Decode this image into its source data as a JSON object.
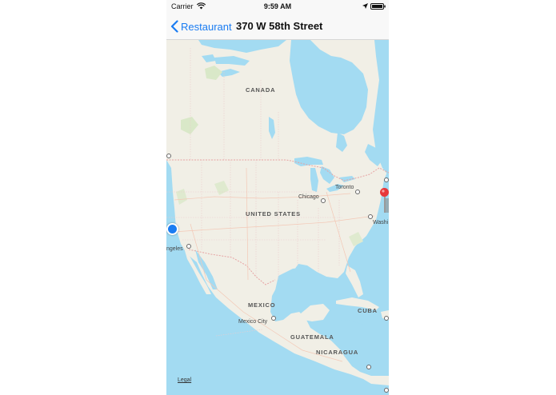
{
  "status_bar": {
    "carrier": "Carrier",
    "time": "9:59 AM"
  },
  "nav": {
    "back_label": "Restaurant",
    "title": "370 W 58th Street"
  },
  "map": {
    "labels": {
      "canada": "CANADA",
      "united_states": "UNITED STATES",
      "mexico": "MEXICO",
      "cuba": "CUBA",
      "guatemala": "GUATEMALA",
      "nicaragua": "NICARAGUA",
      "chicago": "Chicago",
      "toronto": "Toronto",
      "washington": "Washi",
      "los_angeles": "ngeles",
      "mexico_city": "Mexico City"
    },
    "legal": "Legal"
  },
  "colors": {
    "accent": "#1a7cf2",
    "water": "#a3dbf2",
    "land": "#f1efe6",
    "pin": "#e8373a"
  },
  "icons": {
    "wifi": "wifi-icon",
    "location": "location-arrow-icon",
    "battery": "battery-icon",
    "back": "chevron-left-icon",
    "pin": "map-pin-icon"
  }
}
